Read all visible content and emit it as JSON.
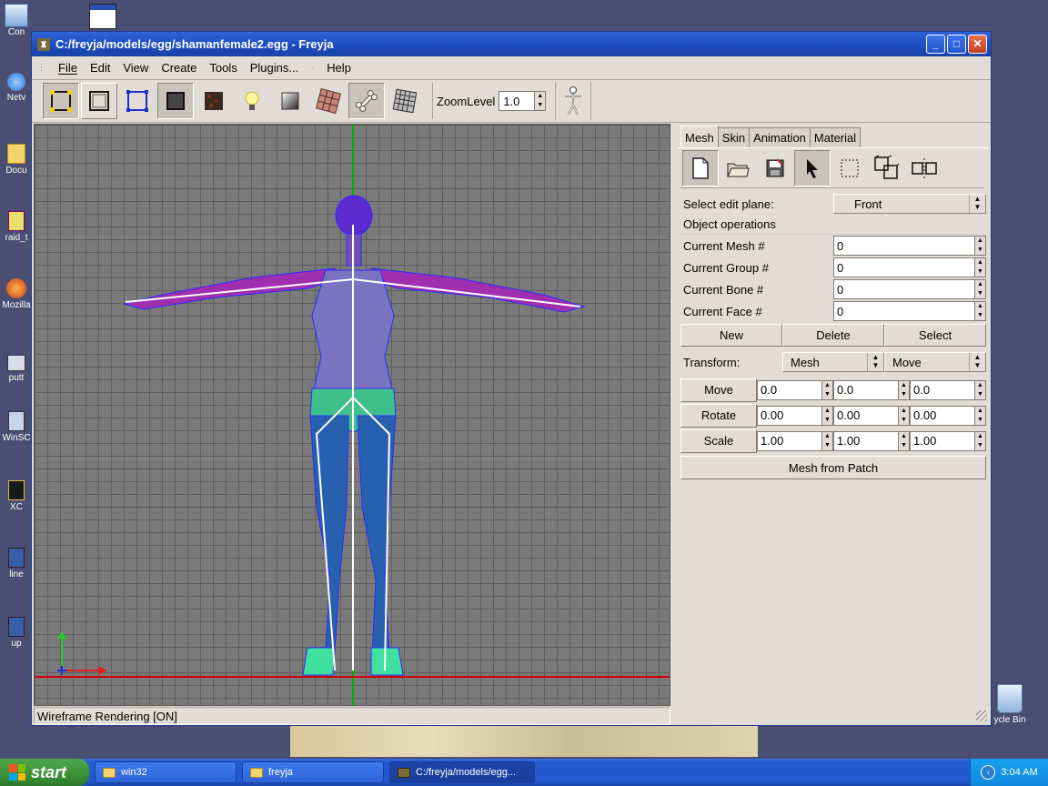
{
  "desktop": {
    "icons": [
      "Con",
      "Netv",
      "Docu",
      "raid_t",
      "Mozilla",
      "putt",
      "WinSC",
      "XC",
      "line",
      "up"
    ],
    "recycle_bin": "ycle Bin"
  },
  "window": {
    "title": "C:/freyja/models/egg/shamanfemale2.egg - Freyja",
    "minimize": "_",
    "maximize": "□",
    "close": "✕"
  },
  "menu": {
    "file": "File",
    "edit": "Edit",
    "view": "View",
    "create": "Create",
    "tools": "Tools",
    "plugins": "Plugins...",
    "help": "Help"
  },
  "toolbar": {
    "zoom_label": "ZoomLevel",
    "zoom_value": "1.0"
  },
  "status": "Wireframe Rendering [ON]",
  "panel": {
    "tabs": [
      "Mesh",
      "Skin",
      "Animation",
      "Material"
    ],
    "edit_plane_label": "Select edit plane:",
    "edit_plane_value": "Front",
    "object_ops": "Object operations",
    "fields": [
      {
        "label": "Current Mesh  #",
        "value": "0"
      },
      {
        "label": "Current Group #",
        "value": "0"
      },
      {
        "label": "Current Bone #",
        "value": "0"
      },
      {
        "label": "Current Face #",
        "value": "0"
      }
    ],
    "buttons": {
      "new": "New",
      "delete": "Delete",
      "select": "Select"
    },
    "transform_label": "Transform:",
    "transform_target": "Mesh",
    "transform_mode": "Move",
    "transform_rows": [
      {
        "label": "Move",
        "x": "0.0",
        "y": "0.0",
        "z": "0.0"
      },
      {
        "label": "Rotate",
        "x": "0.00",
        "y": "0.00",
        "z": "0.00"
      },
      {
        "label": "Scale",
        "x": "1.00",
        "y": "1.00",
        "z": "1.00"
      }
    ],
    "mesh_from_patch": "Mesh from Patch"
  },
  "taskbar": {
    "start": "start",
    "tasks": [
      "win32",
      "freyja",
      "C:/freyja/models/egg..."
    ],
    "clock": "3:04 AM"
  }
}
